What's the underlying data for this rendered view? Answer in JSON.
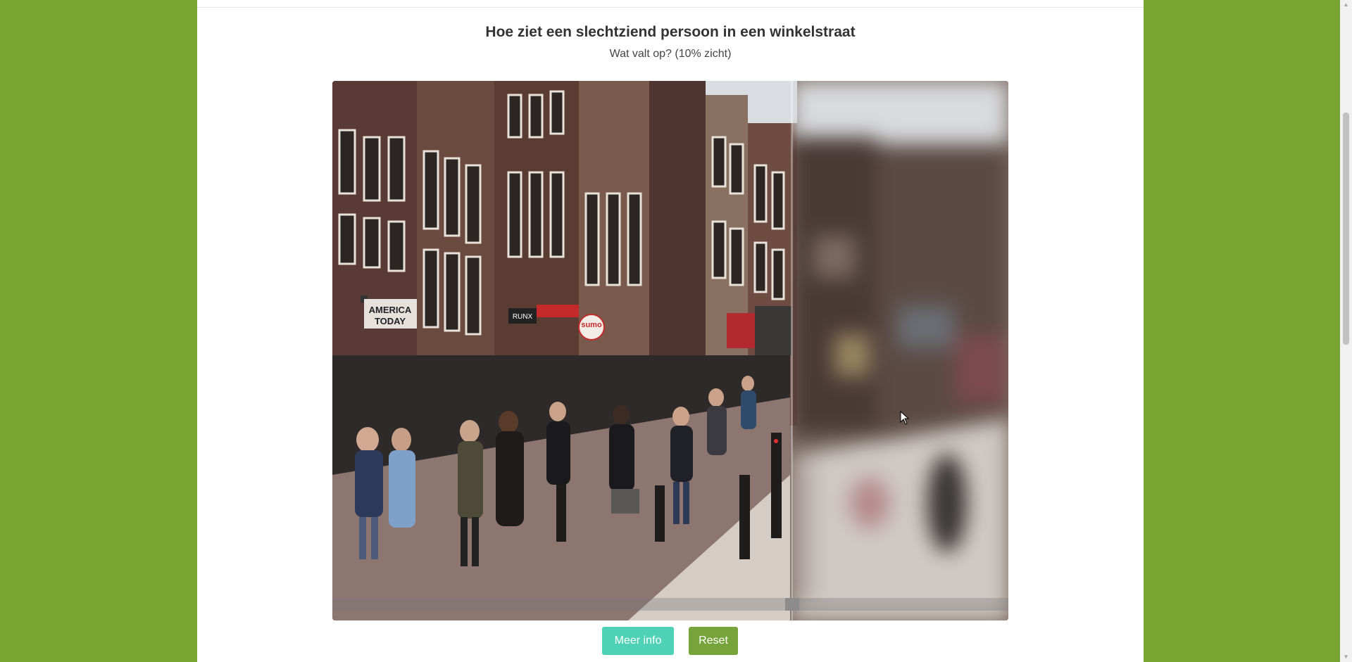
{
  "header": {
    "title": "Hoe ziet een slechtziend persoon in een winkelstraat",
    "subtitle": "Wat valt op? (10% zicht)"
  },
  "image": {
    "signs": [
      "AMERICA",
      "TODAY",
      "RUNX",
      "sumo"
    ]
  },
  "comparison": {
    "split_fraction": 0.68
  },
  "buttons": {
    "info_label": "Meer info",
    "reset_label": "Reset"
  },
  "colors": {
    "background": "#78a532",
    "info_button": "#4fd1b5",
    "reset_button": "#76a33a"
  }
}
